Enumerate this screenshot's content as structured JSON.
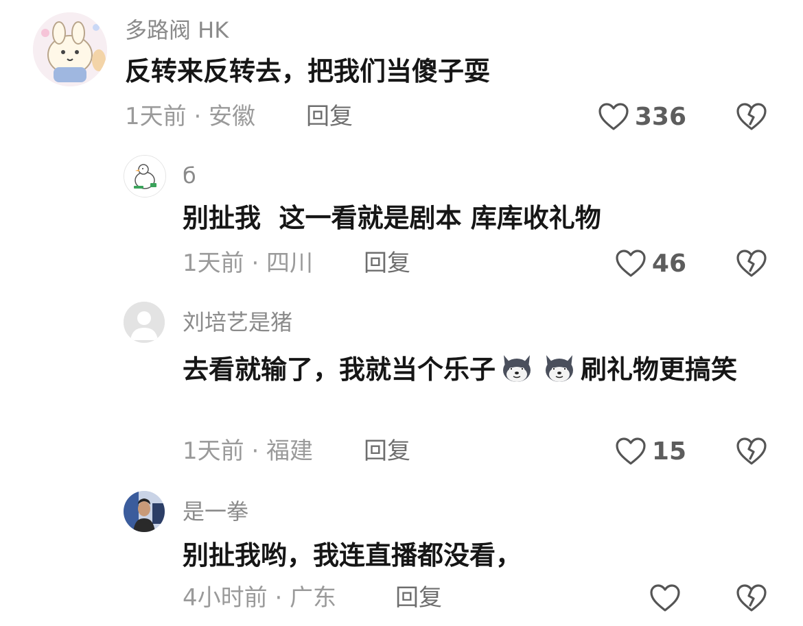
{
  "comments": [
    {
      "username": "多路阀 HK",
      "text": "反转来反转去，把我们当傻子耍",
      "meta": "1天前 · 安徽",
      "reply_label": "回复",
      "likes": "336"
    },
    {
      "username": "б",
      "text": "别扯我  这一看就是剧本 库库收礼物",
      "meta": "1天前 · 四川",
      "reply_label": "回复",
      "likes": "46"
    },
    {
      "username": "刘培艺是猪",
      "text_before": "去看就输了，我就当个乐子",
      "text_after": "刷礼物更搞笑",
      "meta": "1天前 · 福建",
      "reply_label": "回复",
      "likes": "15"
    },
    {
      "username": "是一拳",
      "text": "别扯我哟，我连直播都没看，",
      "meta": "4小时前 · 广东",
      "reply_label": "回复",
      "likes": ""
    }
  ],
  "icons": {
    "like": "heart-outline-icon",
    "dislike": "broken-heart-icon",
    "emoji": "husky-dog-emoji-icon"
  },
  "colors": {
    "username": "#8a8a8a",
    "text": "#161616",
    "meta": "#9a9a9a",
    "icon": "#555555"
  }
}
